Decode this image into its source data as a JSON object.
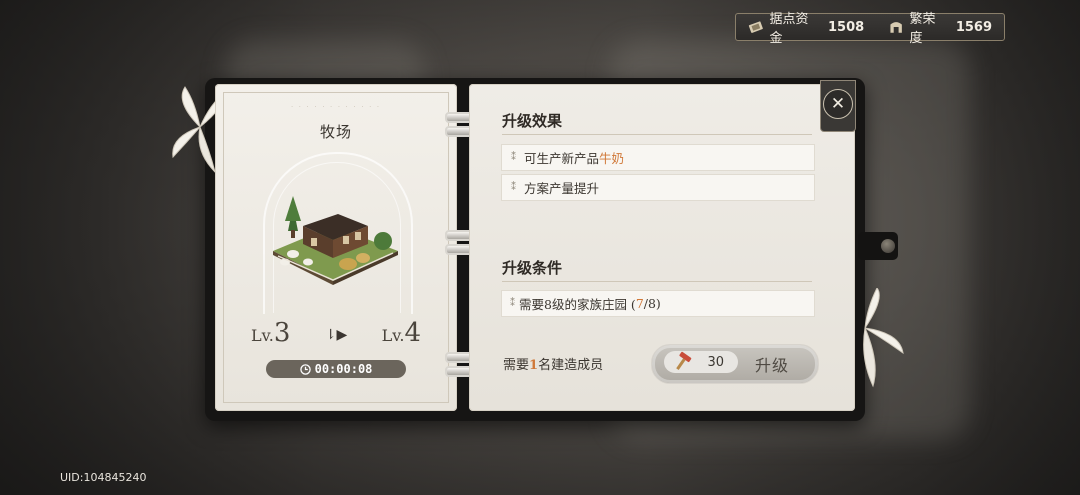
{
  "resources": {
    "funds": {
      "icon": "ticket-icon",
      "label": "据点资金",
      "value": "1508"
    },
    "prosperity": {
      "icon": "gate-icon",
      "label": "繁荣度",
      "value": "1569"
    }
  },
  "building": {
    "name": "牧场",
    "current_level_prefix": "Lv.",
    "current_level": "3",
    "next_level_prefix": "Lv.",
    "next_level": "4",
    "timer": "00:00:08"
  },
  "upgrade_effects": {
    "title": "升级效果",
    "items": [
      {
        "text": "可生产新产品",
        "highlight": "牛奶"
      },
      {
        "text": "方案产量提升",
        "highlight": ""
      }
    ]
  },
  "upgrade_conditions": {
    "title": "升级条件",
    "items": [
      {
        "text": "需要8级的家族庄园 (",
        "highlight": "7",
        "suffix": "/8)"
      }
    ]
  },
  "requirement": {
    "prefix": "需要",
    "count": "1",
    "suffix": "名建造成员"
  },
  "upgrade_button": {
    "cost": "30",
    "label": "升级"
  },
  "uid": "UID:104845240",
  "colors": {
    "highlight": "#d07838",
    "page": "#efece6",
    "binder": "#161514"
  }
}
